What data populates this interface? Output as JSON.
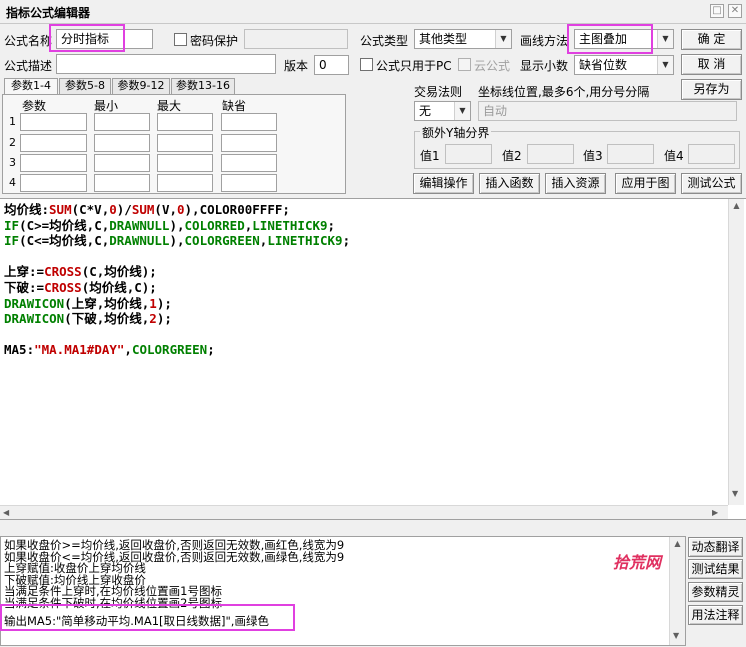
{
  "window": {
    "title": "指标公式编辑器",
    "btn_min": "□",
    "btn_close": "✕"
  },
  "form": {
    "name_label": "公式名称",
    "name_value": "分时指标",
    "password_label": "密码保护",
    "password_value": "",
    "type_label": "公式类型",
    "type_value": "其他类型",
    "draw_label": "画线方法",
    "draw_value": "主图叠加",
    "desc_label": "公式描述",
    "desc_value": "",
    "version_label": "版本",
    "version_value": "0",
    "pc_only_label": "公式只用于PC",
    "cloud_label": "云公式",
    "decimal_label": "显示小数",
    "decimal_value": "缺省位数"
  },
  "buttons": {
    "ok": "确  定",
    "cancel": "取  消",
    "save_as": "另存为",
    "edit_ops": "编辑操作",
    "insert_func": "插入函数",
    "insert_res": "插入资源",
    "apply_chart": "应用于图",
    "test_formula": "测试公式"
  },
  "params": {
    "tabs": [
      "参数1-4",
      "参数5-8",
      "参数9-12",
      "参数13-16"
    ],
    "headers": [
      "参数",
      "最小",
      "最大",
      "缺省"
    ],
    "rows": [
      "1",
      "2",
      "3",
      "4"
    ]
  },
  "trade": {
    "label": "交易法则",
    "value": "无",
    "coord_label": "坐标线位置,最多6个,用分号分隔",
    "coord_value": "自动"
  },
  "yaxis": {
    "title": "额外Y轴分界",
    "labels": [
      "值1",
      "值2",
      "值3",
      "值4"
    ]
  },
  "colors": {
    "default": "#000000",
    "func": "#c00000",
    "num": "#c00000",
    "keyword": "#008000",
    "str": "#c00000"
  },
  "code_lines": [
    [
      {
        "t": "均价线:",
        "c": "default"
      },
      {
        "t": "SUM",
        "c": "func"
      },
      {
        "t": "(C*V,",
        "c": "default"
      },
      {
        "t": "0",
        "c": "num"
      },
      {
        "t": ")/",
        "c": "default"
      },
      {
        "t": "SUM",
        "c": "func"
      },
      {
        "t": "(V,",
        "c": "default"
      },
      {
        "t": "0",
        "c": "num"
      },
      {
        "t": "),COLOR00FFFF;",
        "c": "default"
      }
    ],
    [
      {
        "t": "IF",
        "c": "keyword"
      },
      {
        "t": "(C>=均价线,C,",
        "c": "default"
      },
      {
        "t": "DRAWNULL",
        "c": "keyword"
      },
      {
        "t": "),",
        "c": "default"
      },
      {
        "t": "COLORRED",
        "c": "keyword"
      },
      {
        "t": ",",
        "c": "default"
      },
      {
        "t": "LINETHICK9",
        "c": "keyword"
      },
      {
        "t": ";",
        "c": "default"
      }
    ],
    [
      {
        "t": "IF",
        "c": "keyword"
      },
      {
        "t": "(C<=均价线,C,",
        "c": "default"
      },
      {
        "t": "DRAWNULL",
        "c": "keyword"
      },
      {
        "t": "),",
        "c": "default"
      },
      {
        "t": "COLORGREEN",
        "c": "keyword"
      },
      {
        "t": ",",
        "c": "default"
      },
      {
        "t": "LINETHICK9",
        "c": "keyword"
      },
      {
        "t": ";",
        "c": "default"
      }
    ],
    [],
    [
      {
        "t": "上穿:=",
        "c": "default"
      },
      {
        "t": "CROSS",
        "c": "func"
      },
      {
        "t": "(C,均价线);",
        "c": "default"
      }
    ],
    [
      {
        "t": "下破:=",
        "c": "default"
      },
      {
        "t": "CROSS",
        "c": "func"
      },
      {
        "t": "(均价线,C);",
        "c": "default"
      }
    ],
    [
      {
        "t": "DRAWICON",
        "c": "keyword"
      },
      {
        "t": "(上穿,均价线,",
        "c": "default"
      },
      {
        "t": "1",
        "c": "num"
      },
      {
        "t": ");",
        "c": "default"
      }
    ],
    [
      {
        "t": "DRAWICON",
        "c": "keyword"
      },
      {
        "t": "(下破,均价线,",
        "c": "default"
      },
      {
        "t": "2",
        "c": "num"
      },
      {
        "t": ");",
        "c": "default"
      }
    ],
    [],
    [
      {
        "t": "MA5:",
        "c": "default"
      },
      {
        "t": "\"MA.MA1#DAY\"",
        "c": "str"
      },
      {
        "t": ",",
        "c": "default"
      },
      {
        "t": "COLORGREEN",
        "c": "keyword"
      },
      {
        "t": ";",
        "c": "default"
      }
    ]
  ],
  "description": {
    "lines": [
      "如果收盘价>=均价线,返回收盘价,否则返回无效数,画红色,线宽为9",
      "如果收盘价<=均价线,返回收盘价,否则返回无效数,画绿色,线宽为9",
      "上穿赋值:收盘价上穿均价线",
      "下破赋值:均价线上穿收盘价",
      "当满足条件上穿时,在均价线位置画1号图标",
      "当满足条件下破时,在均价线位置画2号图标",
      "输出MA5:\"简单移动平均.MA1[取日线数据]\",画绿色"
    ],
    "watermark": "拾荒网"
  },
  "side_buttons": [
    "动态翻译",
    "测试结果",
    "参数精灵",
    "用法注释"
  ]
}
